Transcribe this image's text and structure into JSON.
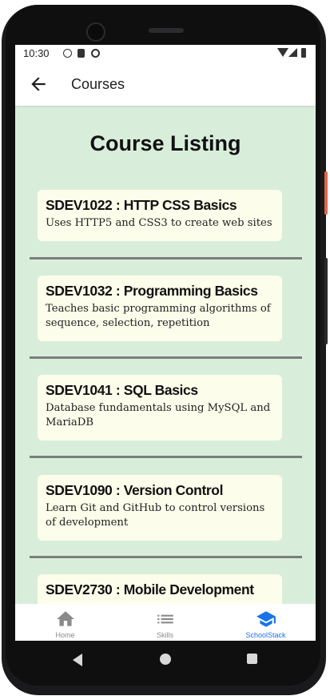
{
  "status_bar": {
    "time": "10:30"
  },
  "app_bar": {
    "title": "Courses"
  },
  "page": {
    "heading": "Course Listing"
  },
  "courses": [
    {
      "title": "SDEV1022 : HTTP CSS Basics",
      "description": "Uses HTTP5 and CSS3 to create web sites"
    },
    {
      "title": "SDEV1032 : Programming Basics",
      "description": "Teaches basic programming algorithms of sequence, selection, repetition"
    },
    {
      "title": "SDEV1041 : SQL Basics",
      "description": "Database fundamentals using MySQL and MariaDB"
    },
    {
      "title": "SDEV1090 : Version Control",
      "description": "Learn Git and GitHub to control versions of development"
    },
    {
      "title": "SDEV2730 : Mobile Development",
      "description": ""
    }
  ],
  "bottom_nav": {
    "items": [
      {
        "label": "Home",
        "icon": "home-icon",
        "active": false
      },
      {
        "label": "Skills",
        "icon": "list-icon",
        "active": false
      },
      {
        "label": "SchoolStack",
        "icon": "school-icon",
        "active": true
      }
    ],
    "active_color": "#1a73e8",
    "inactive_color": "#8a8a8a"
  }
}
